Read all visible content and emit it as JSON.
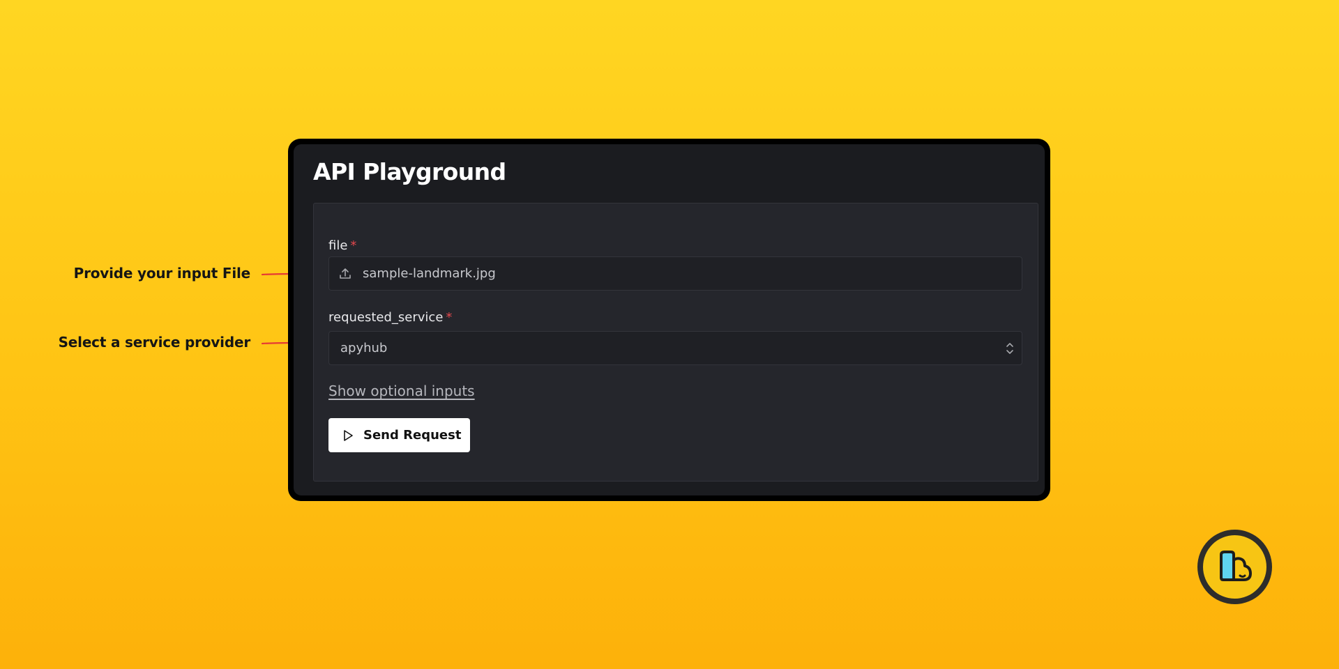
{
  "annotations": {
    "file_hint": "Provide your input File",
    "service_hint": "Select a service provider"
  },
  "window": {
    "title": "API Playground"
  },
  "form": {
    "file_label": "file",
    "file_value": "sample-landmark.jpg",
    "service_label": "requested_service",
    "service_value": "apyhub",
    "required_marker": "*",
    "optional_link": "Show optional inputs",
    "send_label": "Send Request"
  },
  "icons": {
    "upload": "upload-icon",
    "chevrons": "chevron-up-down-icon",
    "play": "play-icon",
    "arrow": "arrow-right-icon",
    "logo": "brand-logo"
  },
  "colors": {
    "background_top": "#ffd622",
    "background_bottom": "#fdb10a",
    "window_bg": "#1b1c20",
    "panel_bg": "#25262c",
    "required": "#e5484d",
    "arrow": "#e53935",
    "logo_cyan": "#5fd4f0"
  }
}
